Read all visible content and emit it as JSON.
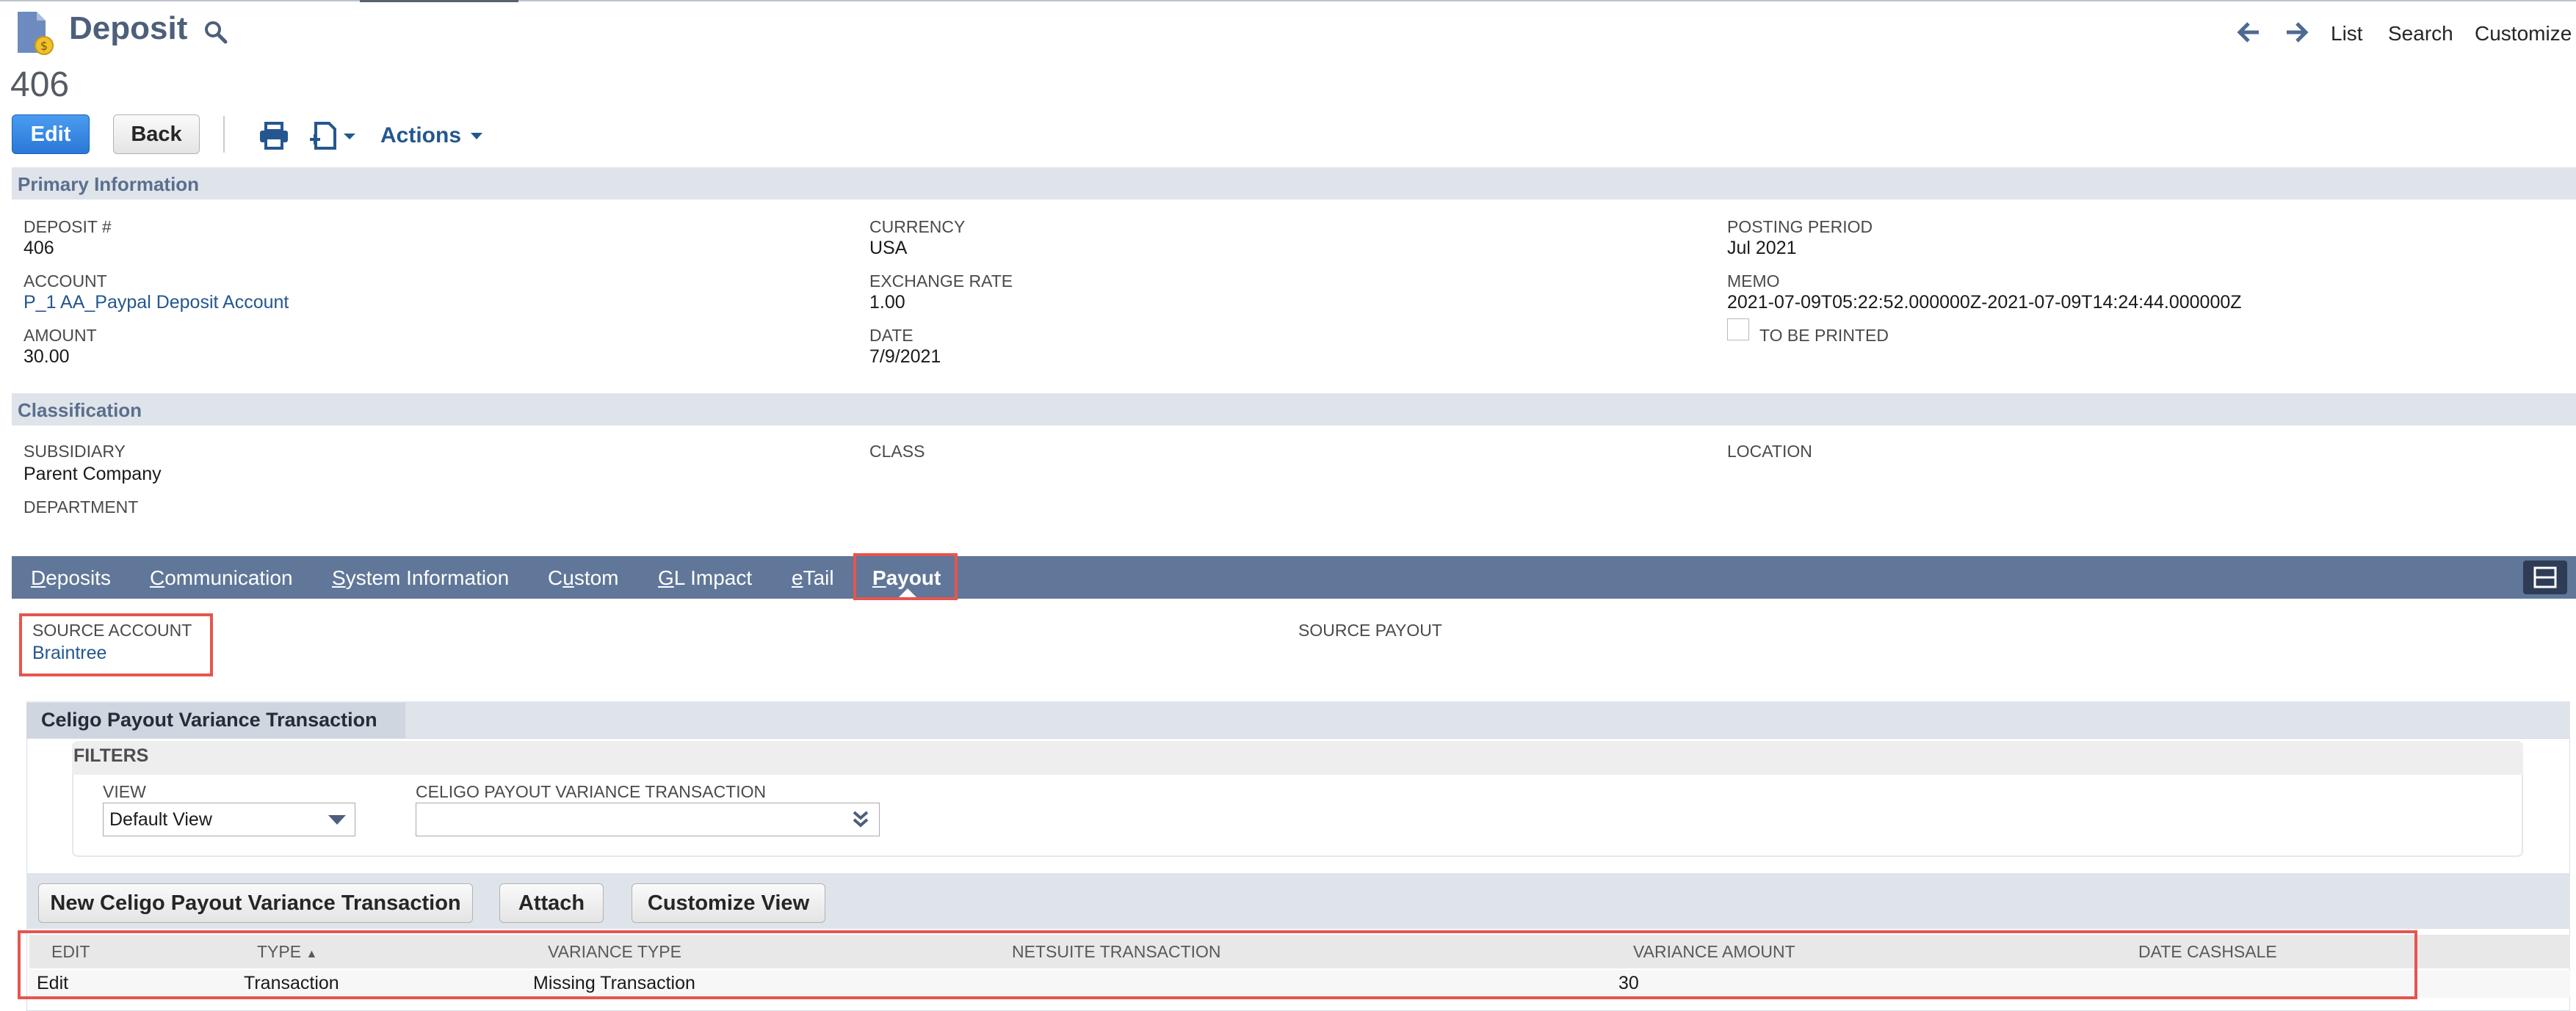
{
  "header": {
    "record_type": "Deposit",
    "record_number": "406",
    "nav": {
      "list": "List",
      "search": "Search",
      "customize": "Customize"
    }
  },
  "toolbar": {
    "edit": "Edit",
    "back": "Back",
    "actions": "Actions"
  },
  "primary": {
    "section_title": "Primary Information",
    "deposit_label": "DEPOSIT #",
    "deposit_value": "406",
    "account_label": "ACCOUNT",
    "account_value": "P_1 AA_Paypal Deposit Account",
    "amount_label": "AMOUNT",
    "amount_value": "30.00",
    "currency_label": "CURRENCY",
    "currency_value": "USA",
    "exchange_label": "EXCHANGE RATE",
    "exchange_value": "1.00",
    "date_label": "DATE",
    "date_value": "7/9/2021",
    "posting_label": "POSTING PERIOD",
    "posting_value": "Jul 2021",
    "memo_label": "MEMO",
    "memo_value": "2021-07-09T05:22:52.000000Z-2021-07-09T14:24:44.000000Z",
    "to_be_printed_label": "TO BE PRINTED"
  },
  "classification": {
    "section_title": "Classification",
    "subsidiary_label": "SUBSIDIARY",
    "subsidiary_value": "Parent Company",
    "department_label": "DEPARTMENT",
    "class_label": "CLASS",
    "location_label": "LOCATION"
  },
  "tabs": {
    "deposits_u": "D",
    "deposits_rest": "eposits",
    "communication_u": "C",
    "communication_rest": "ommunication",
    "sysinfo_u": "S",
    "sysinfo_rest": "ystem Information",
    "custom_a": "C",
    "custom_u": "u",
    "custom_rest": "stom",
    "gl_u": "G",
    "gl_rest": "L Impact",
    "etail_u": "e",
    "etail_rest": "Tail",
    "payout_u": "P",
    "payout_rest": "ayout"
  },
  "payout": {
    "source_account_label": "SOURCE ACCOUNT",
    "source_account_value": "Braintree",
    "source_payout_label": "SOURCE PAYOUT"
  },
  "sublist": {
    "title": "Celigo Payout Variance Transaction",
    "filters_label": "FILTERS",
    "view_label": "VIEW",
    "view_value": "Default View",
    "variance_filter_label": "CELIGO PAYOUT VARIANCE TRANSACTION",
    "variance_filter_value": "",
    "buttons": {
      "new": "New Celigo Payout Variance Transaction",
      "attach": "Attach",
      "customize_view": "Customize View"
    },
    "columns": [
      "EDIT",
      "TYPE",
      "VARIANCE TYPE",
      "NETSUITE TRANSACTION",
      "VARIANCE AMOUNT",
      "DATE CASHSALE"
    ],
    "sort_indicator": "▲",
    "rows": [
      {
        "edit": "Edit",
        "type": "Transaction",
        "variance_type": "Missing Transaction",
        "netsuite_transaction": "",
        "variance_amount": "30",
        "date_cashsale": ""
      }
    ]
  },
  "colors": {
    "accent": "#24578f",
    "tabbar": "#607799",
    "highlight": "#e5554f",
    "section": "#dfe4eb"
  },
  "icons": [
    "deposit-record-icon",
    "search-icon",
    "back-arrow-icon",
    "forward-arrow-icon",
    "print-icon",
    "new-document-icon",
    "chevron-down-icon",
    "sublist-toggle-icon"
  ]
}
